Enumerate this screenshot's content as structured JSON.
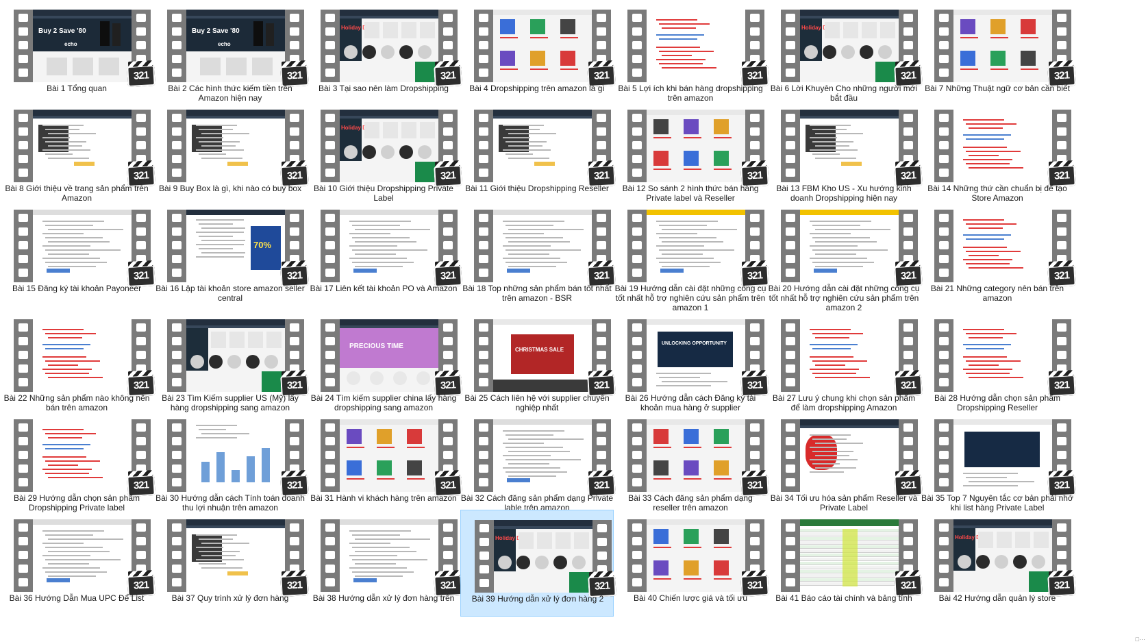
{
  "window": {
    "view": "Extra large icons",
    "corner_text": "□···"
  },
  "badge_label": "321",
  "videos": [
    {
      "label": "Bài 1 Tổng quan",
      "thumb": "amazon-echo-buy2",
      "screen_text": "Buy 2 Save '80"
    },
    {
      "label": "Bài 2 Các hình thức kiếm tiền trên Amazon hiện nay",
      "thumb": "amazon-echo-buy2",
      "screen_text": "Buy 2 Save '80"
    },
    {
      "label": "Bài 3 Tại sao nên làm Dropshipping",
      "thumb": "holiday-deals",
      "screen_text": "Holiday Deals"
    },
    {
      "label": "Bài 4 Dropshipping trên amazon là gì",
      "thumb": "product-grid",
      "screen_text": ""
    },
    {
      "label": "Bài 5 Lợi ích khi bán hàng dropshipping trên amazon",
      "thumb": "document-red",
      "screen_text": ""
    },
    {
      "label": "Bài 6 Lời Khuyên Cho những người mới bắt đầu",
      "thumb": "holiday-deals",
      "screen_text": "Holiday Deals"
    },
    {
      "label": "Bài 7 Những Thuật ngữ cơ bản cần biết",
      "thumb": "product-grid",
      "screen_text": ""
    },
    {
      "label": "Bài 8 Giới thiệu về trang sản phẩm trên Amazon",
      "thumb": "product-page",
      "screen_text": ""
    },
    {
      "label": "Bài 9 Buy Box là gì, khi nào có buy box",
      "thumb": "product-page",
      "screen_text": ""
    },
    {
      "label": "Bài 10 Giới thiệu Dropshipping Private Label",
      "thumb": "holiday-deals",
      "screen_text": "Holiday Deals"
    },
    {
      "label": "Bài 11 Giới thiệu Dropshipping Reseller",
      "thumb": "product-page",
      "screen_text": ""
    },
    {
      "label": "Bài 12 So sánh 2 hình thức bán hàng Private label và Reseller",
      "thumb": "product-grid",
      "screen_text": ""
    },
    {
      "label": "Bài 13 FBM Kho US - Xu hướng kinh doanh Dropshipping hiện nay",
      "thumb": "product-page",
      "screen_text": ""
    },
    {
      "label": "Bài 14 Những thứ cần chuẩn bị để tạo Store Amazon",
      "thumb": "document-red",
      "screen_text": ""
    },
    {
      "label": "Bài 15 Đăng ký tài khoản Payoneer",
      "thumb": "form",
      "screen_text": ""
    },
    {
      "label": "Bài 16 Lập tài khoản store amazon seller central",
      "thumb": "promo-70",
      "screen_text": "70%"
    },
    {
      "label": "Bài 17 Liên kết tài khoản PO và Amazon",
      "thumb": "form",
      "screen_text": ""
    },
    {
      "label": "Bài 18 Top những sản phẩm bán tốt nhất trên amazon - BSR",
      "thumb": "form",
      "screen_text": ""
    },
    {
      "label": "Bài 19 Hướng dẫn cài đặt những công cụ tốt nhất hỗ trợ nghiên cứu sản phẩm trên amazon 1",
      "thumb": "form-yellow",
      "screen_text": ""
    },
    {
      "label": "Bài 20 Hướng dẫn cài đặt những công cụ tốt nhất hỗ trợ nghiên cứu sản phẩm trên amazon 2",
      "thumb": "form-yellow",
      "screen_text": ""
    },
    {
      "label": "Bài 21 Những category nên bán trên amazon",
      "thumb": "document-red",
      "screen_text": ""
    },
    {
      "label": "Bài 22 Những sản phẩm nào không nên bán trên amazon",
      "thumb": "document-red",
      "screen_text": ""
    },
    {
      "label": "Bài 23 Tìm Kiếm supplier US (Mỹ) lấy hàng dropshipping sang amazon",
      "thumb": "holiday-deals",
      "screen_text": ""
    },
    {
      "label": "Bài 24 Tìm kiếm supplier china lấy hàng dropshipping sang amazon",
      "thumb": "banner-purple",
      "screen_text": "PRECIOUS TIME"
    },
    {
      "label": "Bài 25 Cách liên hệ với supplier chuyên nghiệp nhất",
      "thumb": "banner-red",
      "screen_text": "CHRISTMAS SALE"
    },
    {
      "label": "Bài 26 Hướng dẫn cách Đăng ký tài khoản mua hàng ở supplier",
      "thumb": "banner-dark",
      "screen_text": "UNLOCKING OPPORTUNITY"
    },
    {
      "label": "Bài 27 Lưu ý chung khi chọn sản phẩm để làm dropshipping Amazon",
      "thumb": "document-red",
      "screen_text": ""
    },
    {
      "label": "Bài 28 Hướng dẫn chọn sản phẩm Dropshipping Reseller",
      "thumb": "document-red",
      "screen_text": ""
    },
    {
      "label": "Bài 29 Hướng dẫn chọn sản phẩm Dropshipping Private label",
      "thumb": "document-red",
      "screen_text": ""
    },
    {
      "label": "Bài 30 Hướng dẫn cách Tính toán doanh thu lợi nhuận trên amazon",
      "thumb": "chart-blue",
      "screen_text": ""
    },
    {
      "label": "Bài 31 Hành vi khách hàng trên amazon",
      "thumb": "product-grid",
      "screen_text": ""
    },
    {
      "label": "Bài 32 Cách đăng sản phẩm dạng Private lable trên amazon",
      "thumb": "form",
      "screen_text": ""
    },
    {
      "label": "Bài 33 Cách đăng sản phẩm dạng reseller trên amazon",
      "thumb": "product-grid",
      "screen_text": ""
    },
    {
      "label": "Bài 34 Tối ưu hóa sản phẩm Reseller và Private Label",
      "thumb": "product-red",
      "screen_text": ""
    },
    {
      "label": "Bài 35 Top 7 Nguyên tắc cơ bản phải nhớ khi list hàng Private Label",
      "thumb": "banner-dark",
      "screen_text": ""
    },
    {
      "label": "Bài 36 Hướng Dẫn Mua UPC Để List",
      "thumb": "form",
      "screen_text": ""
    },
    {
      "label": "Bài 37 Quy trình xử lý đơn hàng",
      "thumb": "product-page",
      "screen_text": ""
    },
    {
      "label": "Bài 38 Hướng dẫn xử lý đơn hàng trên",
      "thumb": "form",
      "screen_text": ""
    },
    {
      "label": "Bài 39 Hướng dẫn xử lý đơn hàng 2",
      "thumb": "holiday-deals",
      "screen_text": "Holiday Deals"
    },
    {
      "label": "Bài 40 Chiến lược giá và tối ưu",
      "thumb": "product-grid",
      "screen_text": ""
    },
    {
      "label": "Bài 41 Báo cáo tài chính và bảng tính",
      "thumb": "spreadsheet",
      "screen_text": ""
    },
    {
      "label": "Bài 42 Hướng dẫn quản lý store",
      "thumb": "holiday-deals",
      "screen_text": "Holiday Deals"
    }
  ],
  "selected_index": 38,
  "colors": {
    "selection_bg": "#cce8ff",
    "film": "#6c6c6c",
    "amazon_nav": "#232f3e",
    "deal_red": "#e03a3a"
  }
}
